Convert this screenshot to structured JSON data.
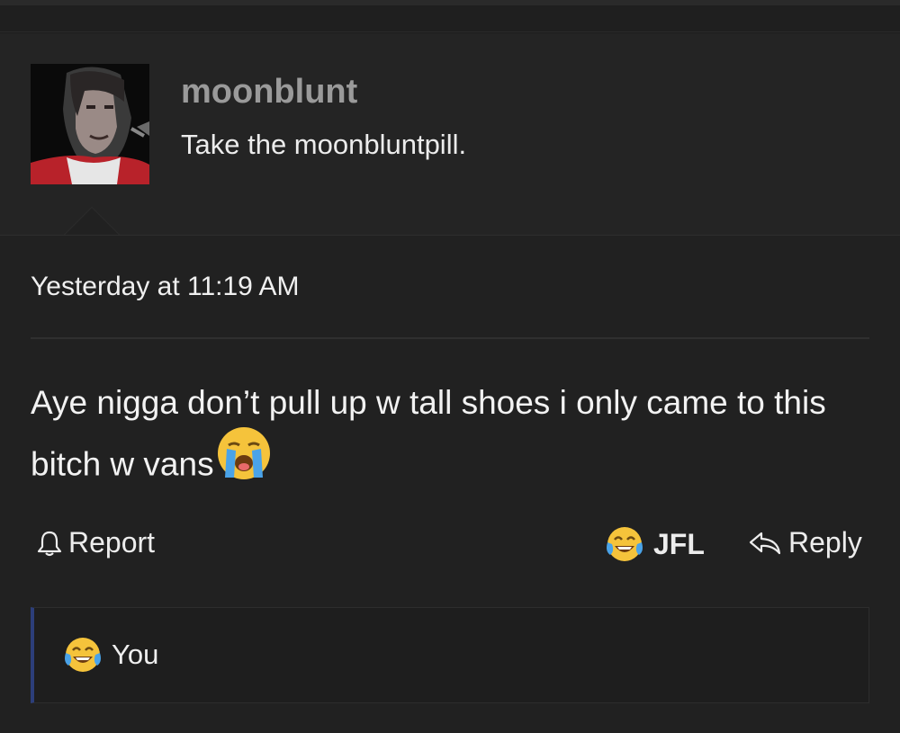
{
  "post": {
    "username": "moonblunt",
    "user_title": "Take the moonbluntpill.",
    "timestamp": "Yesterday at 11:19 AM",
    "message_text": "Aye nigga don’t pull up w tall shoes i only came to this bitch w vans",
    "message_emoji": "loudly-crying-face-icon"
  },
  "actions": {
    "report_label": "Report",
    "reaction_label": "JFL",
    "reaction_icon": "tears-of-joy-icon",
    "reply_label": "Reply"
  },
  "reactions_summary": {
    "icon": "tears-of-joy-icon",
    "label": "You"
  },
  "colors": {
    "background": "#212121",
    "user_block": "#242424",
    "username": "#9a9a9a",
    "text": "#f2f2f2",
    "reaction_bar_accent": "#2c3e7a"
  }
}
